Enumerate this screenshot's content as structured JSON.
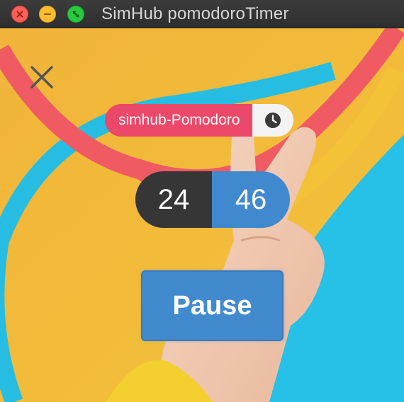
{
  "window": {
    "title": "SimHub pomodoroTimer"
  },
  "project": {
    "name": "simhub-Pomodoro",
    "history_icon": "clock-icon"
  },
  "timer": {
    "minutes": "24",
    "seconds": "46"
  },
  "controls": {
    "pause_label": "Pause",
    "close_icon": "close-x-icon"
  },
  "colors": {
    "project_pill": "#ec4869",
    "minutes_bg": "#363636",
    "seconds_bg": "#4189cf",
    "pause_button": "#418acd",
    "background_yellow": "#f1b93a",
    "background_cyan": "#27c0e6",
    "ring_coral": "#f05a63"
  }
}
